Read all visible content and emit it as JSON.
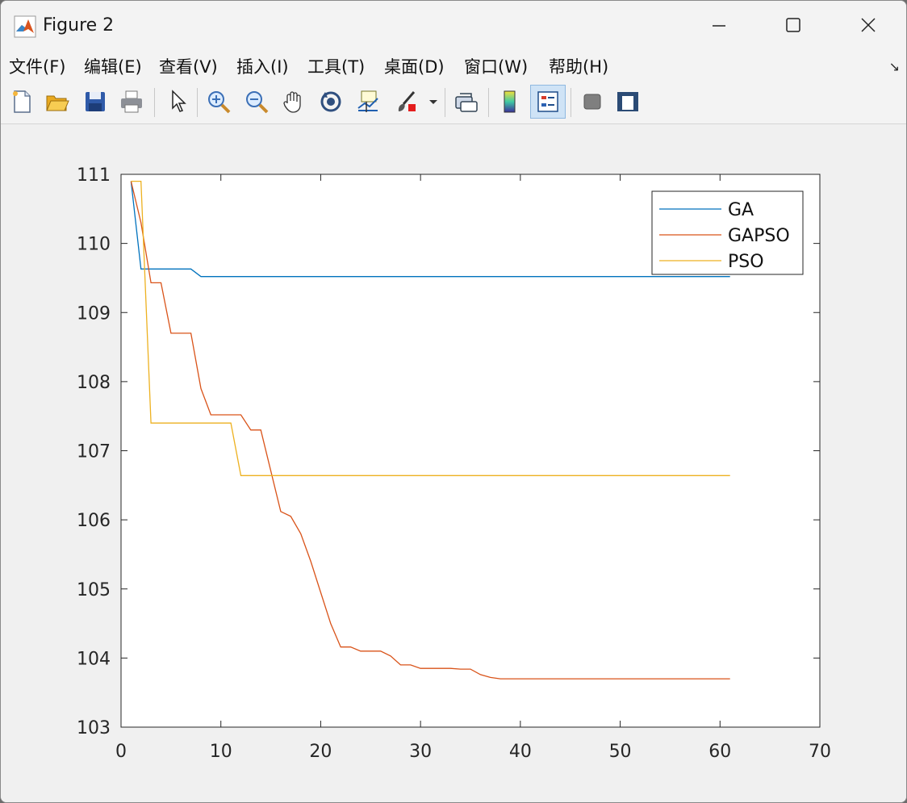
{
  "window": {
    "title": "Figure 2",
    "minimize_label": "minimize",
    "maximize_label": "maximize",
    "close_label": "close"
  },
  "menu": {
    "items": [
      {
        "label": "文件(F)"
      },
      {
        "label": "编辑(E)"
      },
      {
        "label": "查看(V)"
      },
      {
        "label": "插入(I)"
      },
      {
        "label": "工具(T)"
      },
      {
        "label": "桌面(D)"
      },
      {
        "label": "窗口(W)"
      },
      {
        "label": "帮助(H)"
      }
    ]
  },
  "toolbar": {
    "icons": [
      "new-figure-icon",
      "open-file-icon",
      "save-icon",
      "print-icon",
      "select-arrow-icon",
      "zoom-in-icon",
      "zoom-out-icon",
      "pan-hand-icon",
      "rotate-3d-icon",
      "data-cursor-icon",
      "brush-icon",
      "link-plot-icon",
      "colorbar-icon",
      "legend-icon",
      "hide-plot-tools-icon",
      "show-plot-tools-icon"
    ],
    "legend_active": true
  },
  "colors": {
    "ga": "#0072BD",
    "gapso": "#D95319",
    "pso": "#EDB120"
  },
  "chart_data": {
    "type": "line",
    "title": "",
    "xlabel": "",
    "ylabel": "",
    "xlim": [
      0,
      70
    ],
    "ylim": [
      103,
      111
    ],
    "xticks": [
      0,
      10,
      20,
      30,
      40,
      50,
      60,
      70
    ],
    "yticks": [
      103,
      104,
      105,
      106,
      107,
      108,
      109,
      110,
      111
    ],
    "grid": false,
    "legend_position": "top-right",
    "series": [
      {
        "name": "GA",
        "x": [
          1,
          2,
          7,
          8,
          61
        ],
        "y": [
          110.9,
          109.63,
          109.63,
          109.52,
          109.52
        ]
      },
      {
        "name": "GAPSO",
        "x": [
          1,
          2,
          3,
          4,
          5,
          7,
          8,
          9,
          12,
          13,
          14,
          16,
          17,
          18,
          19,
          20,
          21,
          22,
          23,
          24,
          26,
          27,
          28,
          29,
          30,
          33,
          34,
          35,
          36,
          37,
          38,
          61
        ],
        "y": [
          110.9,
          110.3,
          109.43,
          109.43,
          108.7,
          108.7,
          107.9,
          107.52,
          107.52,
          107.3,
          107.3,
          106.12,
          106.05,
          105.8,
          105.4,
          104.95,
          104.5,
          104.16,
          104.16,
          104.1,
          104.1,
          104.03,
          103.9,
          103.9,
          103.85,
          103.85,
          103.84,
          103.84,
          103.76,
          103.72,
          103.7,
          103.7
        ]
      },
      {
        "name": "PSO",
        "x": [
          1,
          2,
          3,
          11,
          12,
          61
        ],
        "y": [
          110.9,
          110.9,
          107.4,
          107.4,
          106.64,
          106.64
        ]
      }
    ]
  }
}
